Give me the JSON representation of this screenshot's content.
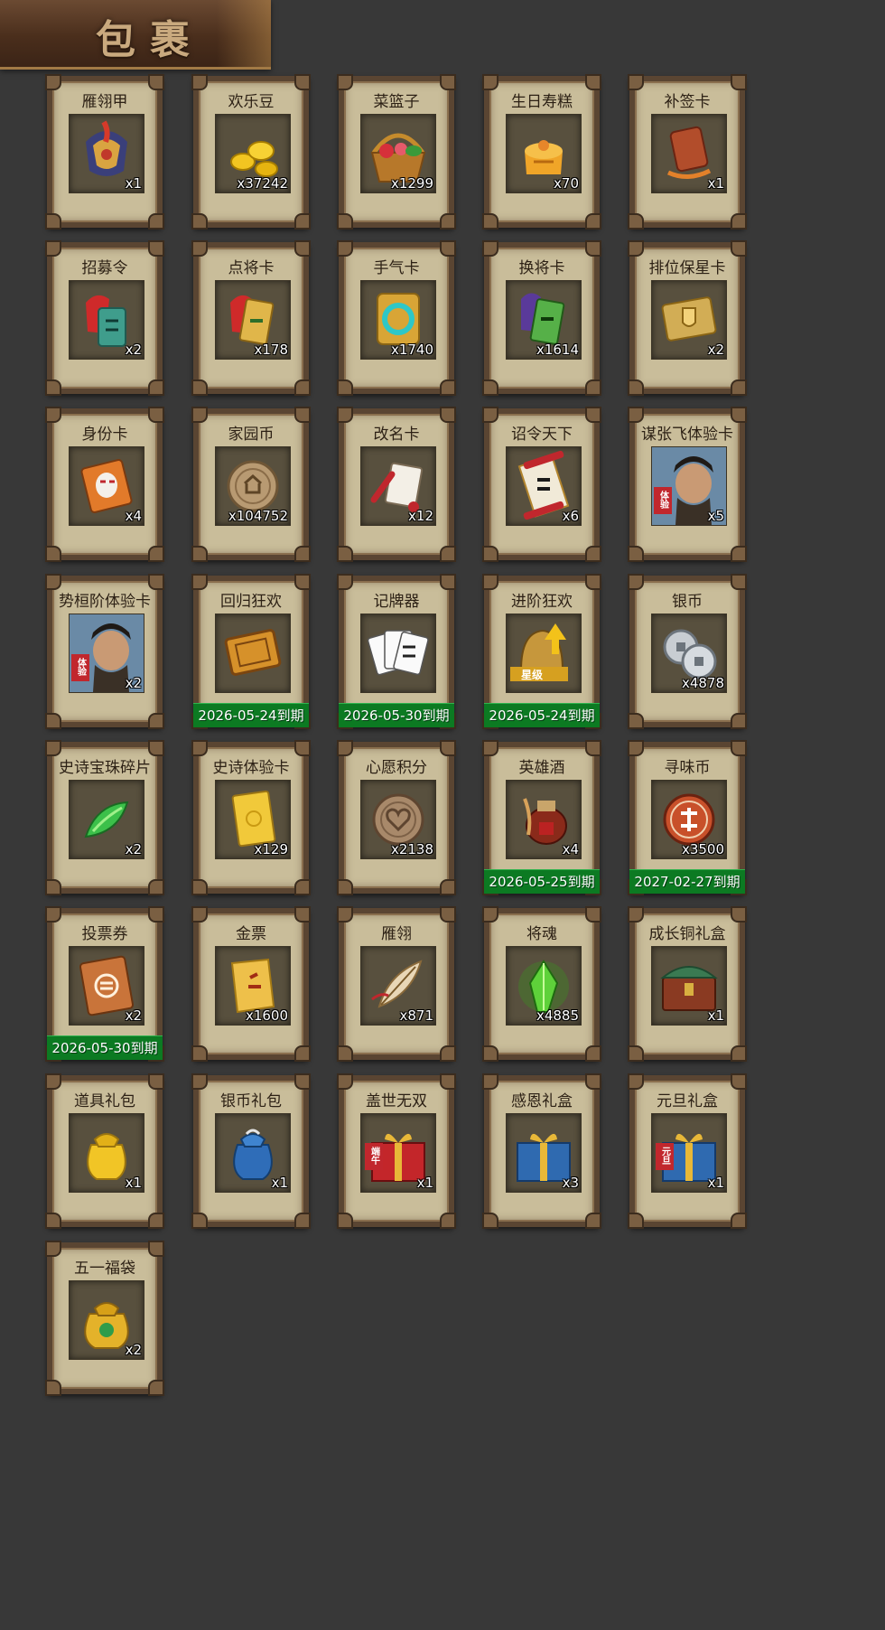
{
  "header": {
    "title": "包裹"
  },
  "items": [
    {
      "name": "雁翎甲",
      "count": "x1",
      "expiry": "",
      "icon": "armor-icon"
    },
    {
      "name": "欢乐豆",
      "count": "x37242",
      "expiry": "",
      "icon": "beans-icon"
    },
    {
      "name": "菜篮子",
      "count": "x1299",
      "expiry": "",
      "icon": "basket-icon"
    },
    {
      "name": "生日寿糕",
      "count": "x70",
      "expiry": "",
      "icon": "cake-icon"
    },
    {
      "name": "补签卡",
      "count": "x1",
      "expiry": "",
      "icon": "sign-card-icon"
    },
    {
      "name": "招募令",
      "count": "x2",
      "expiry": "",
      "icon": "recruit-token-icon"
    },
    {
      "name": "点将卡",
      "count": "x178",
      "expiry": "",
      "icon": "general-card-icon"
    },
    {
      "name": "手气卡",
      "count": "x1740",
      "expiry": "",
      "icon": "luck-card-icon"
    },
    {
      "name": "换将卡",
      "count": "x1614",
      "expiry": "",
      "icon": "swap-card-icon"
    },
    {
      "name": "排位保星卡",
      "count": "x2",
      "expiry": "",
      "icon": "shield-card-icon"
    },
    {
      "name": "身份卡",
      "count": "x4",
      "expiry": "",
      "icon": "identity-card-icon"
    },
    {
      "name": "家园币",
      "count": "x104752",
      "expiry": "",
      "icon": "home-coin-icon"
    },
    {
      "name": "改名卡",
      "count": "x12",
      "expiry": "",
      "icon": "rename-card-icon"
    },
    {
      "name": "诏令天下",
      "count": "x6",
      "expiry": "",
      "icon": "edict-scroll-icon"
    },
    {
      "name": "谋张飞体验卡",
      "count": "x5",
      "expiry": "",
      "icon": "hero-portrait-icon",
      "badge": "体验"
    },
    {
      "name": "势桓阶体验卡",
      "count": "x2",
      "expiry": "",
      "icon": "hero-portrait-icon",
      "badge": "体验"
    },
    {
      "name": "回归狂欢",
      "count": "",
      "expiry": "2026-05-24到期",
      "icon": "return-ticket-icon"
    },
    {
      "name": "记牌器",
      "count": "",
      "expiry": "2026-05-30到期",
      "icon": "playing-cards-icon"
    },
    {
      "name": "进阶狂欢",
      "count": "",
      "expiry": "2026-05-24到期",
      "icon": "star-upgrade-icon",
      "badge": "星级"
    },
    {
      "name": "银币",
      "count": "x4878",
      "expiry": "",
      "icon": "silver-coins-icon"
    },
    {
      "name": "史诗宝珠碎片",
      "count": "x2",
      "expiry": "",
      "icon": "jade-shard-icon"
    },
    {
      "name": "史诗体验卡",
      "count": "x129",
      "expiry": "",
      "icon": "gold-card-icon"
    },
    {
      "name": "心愿积分",
      "count": "x2138",
      "expiry": "",
      "icon": "heart-coin-icon"
    },
    {
      "name": "英雄酒",
      "count": "x4",
      "expiry": "2026-05-25到期",
      "icon": "wine-jar-icon"
    },
    {
      "name": "寻味币",
      "count": "x3500",
      "expiry": "2027-02-27到期",
      "icon": "taste-coin-icon"
    },
    {
      "name": "投票券",
      "count": "x2",
      "expiry": "2026-05-30到期",
      "icon": "vote-ticket-icon"
    },
    {
      "name": "金票",
      "count": "x1600",
      "expiry": "",
      "icon": "gold-ticket-icon"
    },
    {
      "name": "雁翎",
      "count": "x871",
      "expiry": "",
      "icon": "feather-icon"
    },
    {
      "name": "将魂",
      "count": "x4885",
      "expiry": "",
      "icon": "soul-crystal-icon"
    },
    {
      "name": "成长铜礼盒",
      "count": "x1",
      "expiry": "",
      "icon": "chest-icon"
    },
    {
      "name": "道具礼包",
      "count": "x1",
      "expiry": "",
      "icon": "gold-bag-icon"
    },
    {
      "name": "银币礼包",
      "count": "x1",
      "expiry": "",
      "icon": "blue-bag-icon"
    },
    {
      "name": "盖世无双",
      "count": "x1",
      "expiry": "",
      "icon": "red-giftbox-icon",
      "badge": "端午"
    },
    {
      "name": "感恩礼盒",
      "count": "x3",
      "expiry": "",
      "icon": "blue-giftbox-icon"
    },
    {
      "name": "元旦礼盒",
      "count": "x1",
      "expiry": "",
      "icon": "blue-giftbox-icon",
      "badge": "元旦"
    },
    {
      "name": "五一福袋",
      "count": "x2",
      "expiry": "",
      "icon": "lucky-bag-icon"
    }
  ],
  "colors": {
    "background": "#383838",
    "card": "#c9bd9a",
    "frame": "#5a4532",
    "expiry_bar": "#0c7a22"
  }
}
